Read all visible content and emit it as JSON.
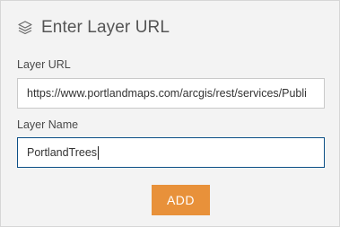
{
  "header": {
    "icon": "layers-icon",
    "title": "Enter Layer URL"
  },
  "form": {
    "url_label": "Layer URL",
    "url_value": "https://www.portlandmaps.com/arcgis/rest/services/Publi",
    "name_label": "Layer Name",
    "name_value": "PortlandTrees",
    "add_label": "ADD"
  },
  "colors": {
    "accent_button": "#e8913a",
    "focus_border": "#0c4f86",
    "panel_bg": "#f3f3f3"
  }
}
